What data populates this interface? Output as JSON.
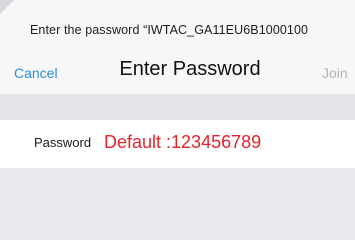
{
  "dialog": {
    "prompt": "Enter the password “IWTAC_GA11EU6B1000100"
  },
  "nav": {
    "cancel_label": "Cancel",
    "title": "Enter Password",
    "join_label": "Join"
  },
  "form": {
    "password_label": "Password",
    "password_placeholder": "Default :123456789"
  },
  "colors": {
    "accent": "#2b8fd8",
    "placeholder_red": "#e8222b",
    "disabled": "#b5b5b9"
  }
}
